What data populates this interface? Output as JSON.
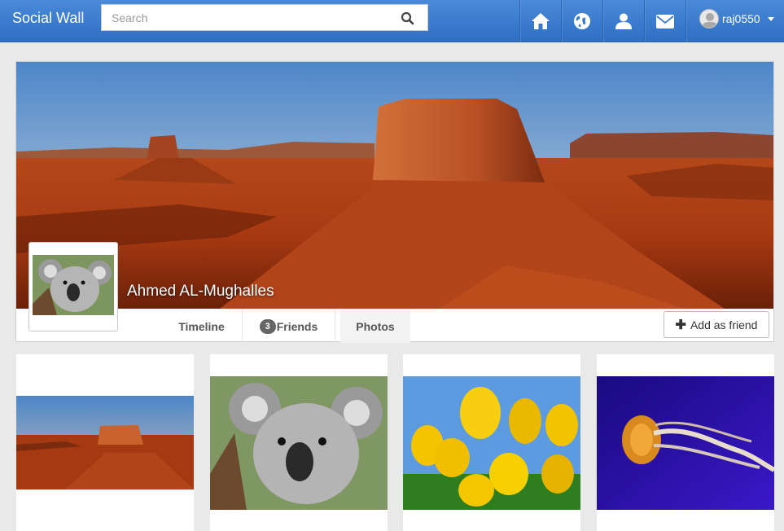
{
  "navbar": {
    "brand": "Social Wall",
    "search_placeholder": "Search",
    "icons": [
      "home-icon",
      "globe-icon",
      "user-icon",
      "envelope-icon"
    ],
    "username": "raj0550"
  },
  "profile": {
    "name": "Ahmed AL-Mughalles",
    "tabs": {
      "timeline": "Timeline",
      "friends_count": "3",
      "friends": "Friends",
      "photos": "Photos"
    },
    "add_friend": "Add as friend"
  },
  "photos": [
    "desert-landscape",
    "koala",
    "yellow-tulips",
    "jellyfish"
  ],
  "colors": {
    "navbar": "#3a7ccf",
    "background": "#e9e9e9"
  }
}
